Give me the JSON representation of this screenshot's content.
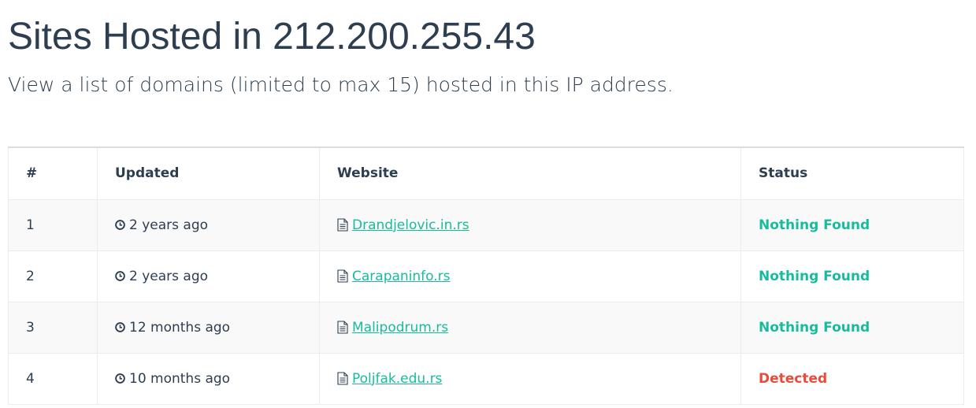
{
  "page": {
    "title": "Sites Hosted in 212.200.255.43",
    "subtitle": "View a list of domains (limited to max 15) hosted in this IP address."
  },
  "colors": {
    "heading": "#2c3e50",
    "link": "#18bc9c",
    "status_ok": "#18bc9c",
    "status_bad": "#e74c3c"
  },
  "table": {
    "headers": {
      "num": "#",
      "updated": "Updated",
      "website": "Website",
      "status": "Status"
    },
    "rows": [
      {
        "num": "1",
        "updated": "2 years ago",
        "website": "Drandjelovic.in.rs",
        "status": "Nothing Found",
        "status_color": "#18bc9c"
      },
      {
        "num": "2",
        "updated": "2 years ago",
        "website": "Carapaninfo.rs",
        "status": "Nothing Found",
        "status_color": "#18bc9c"
      },
      {
        "num": "3",
        "updated": "12 months ago",
        "website": "Malipodrum.rs",
        "status": "Nothing Found",
        "status_color": "#18bc9c"
      },
      {
        "num": "4",
        "updated": "10 months ago",
        "website": "Poljfak.edu.rs",
        "status": "Detected",
        "status_color": "#e74c3c"
      }
    ]
  },
  "icons": {
    "updated": "clock-icon",
    "website": "document-icon"
  }
}
